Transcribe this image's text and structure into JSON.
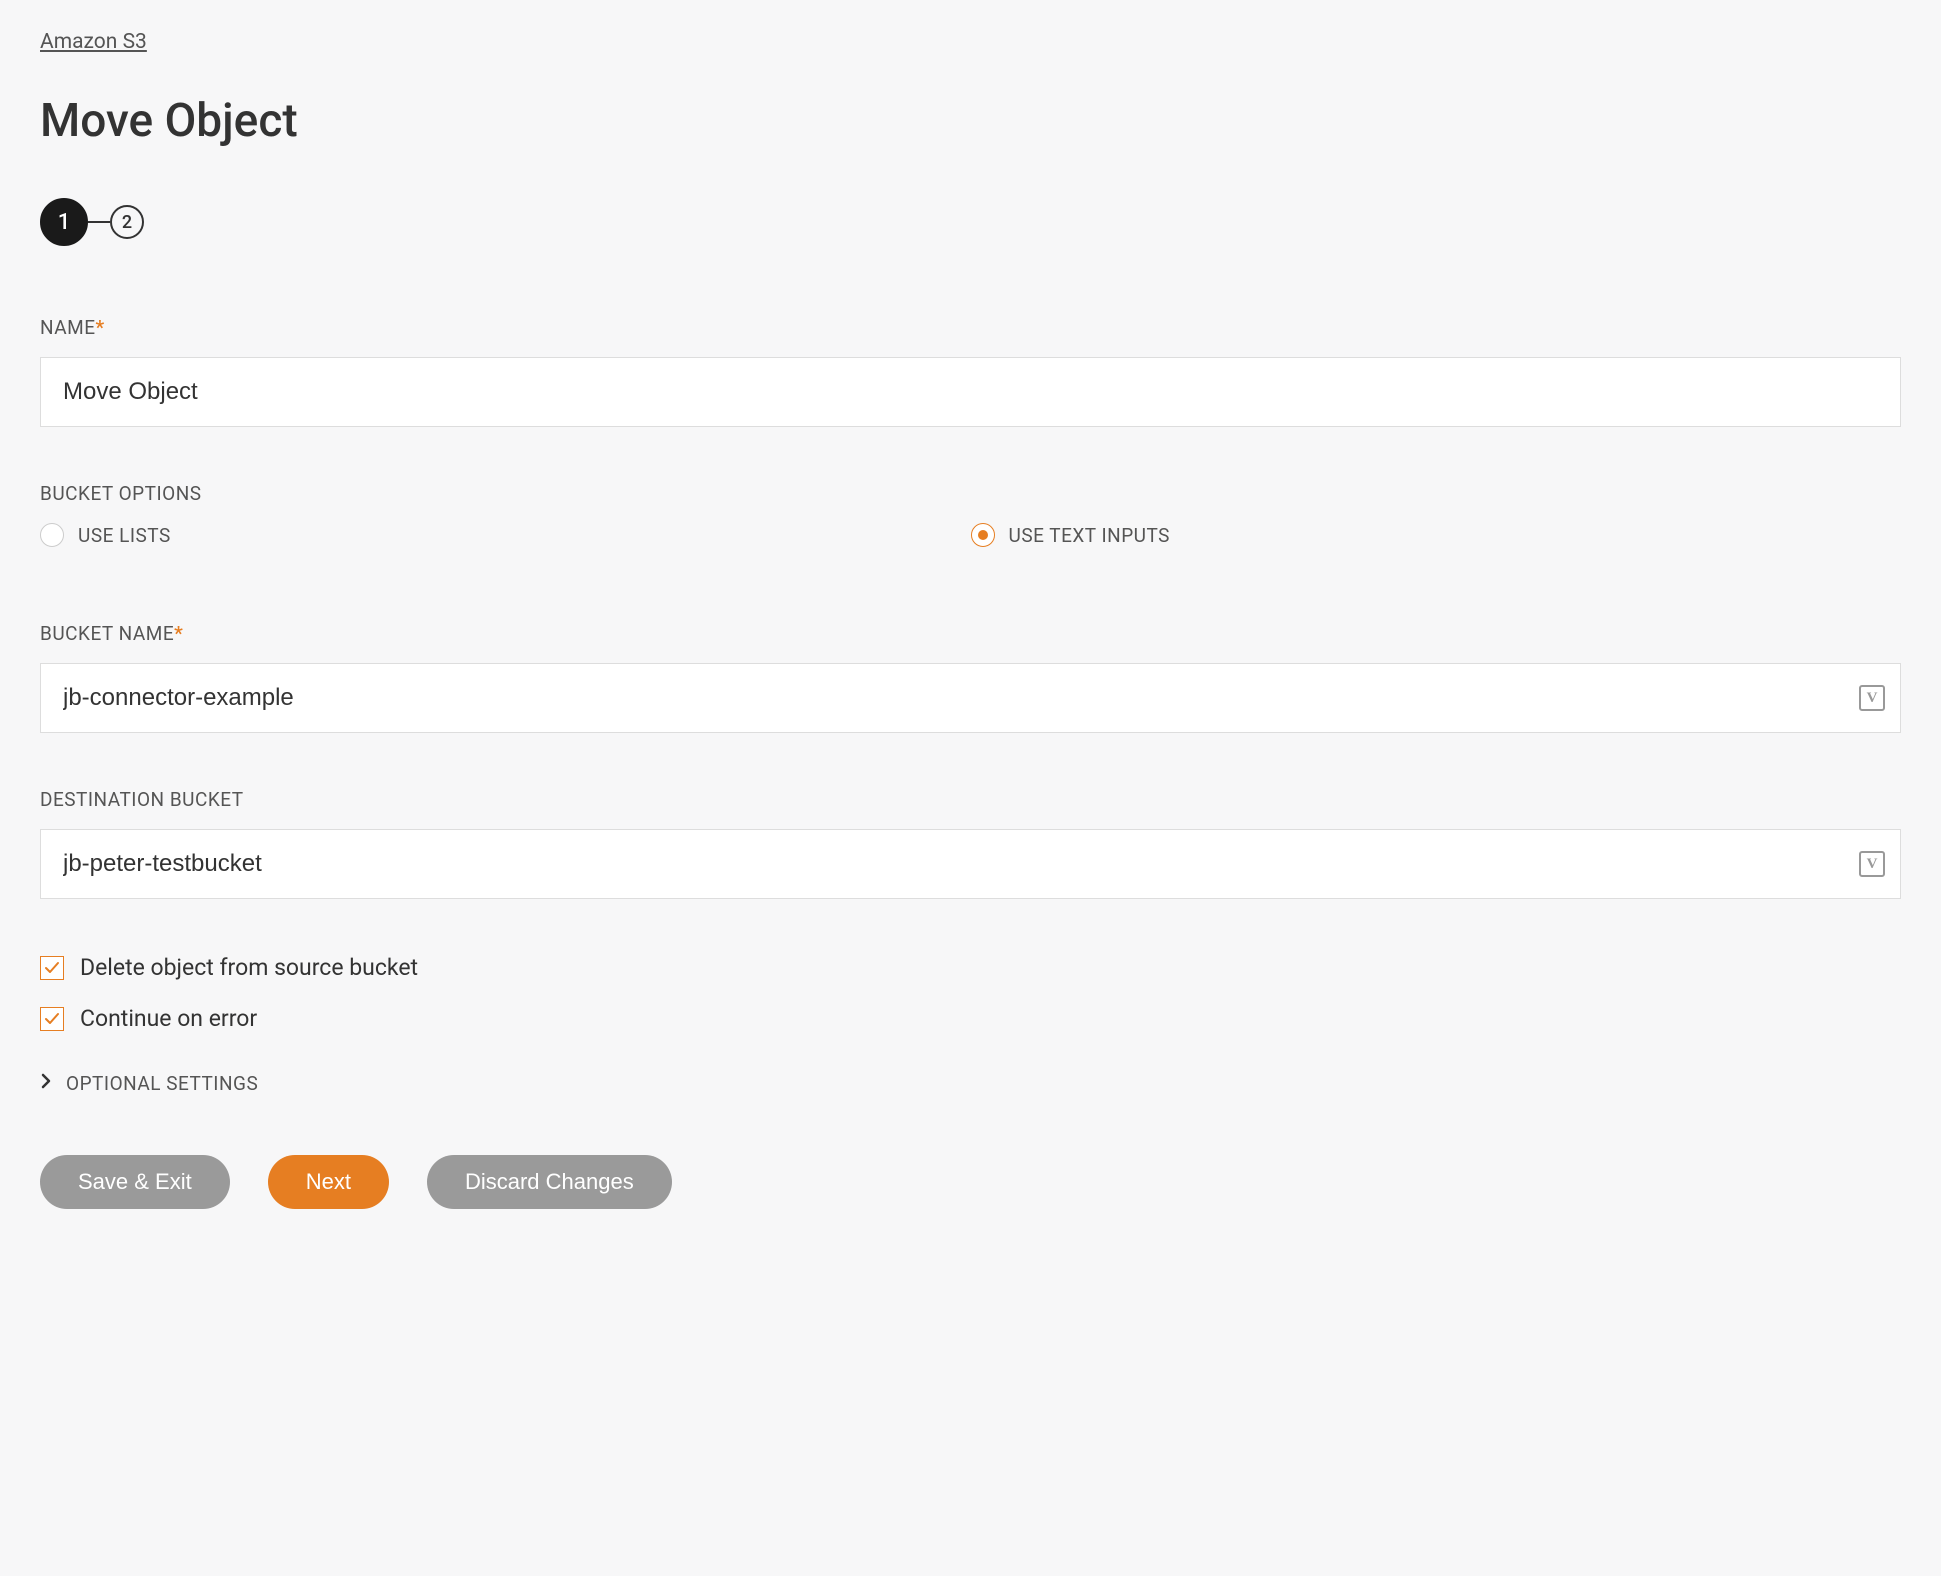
{
  "breadcrumb": {
    "label": "Amazon S3"
  },
  "page": {
    "title": "Move Object"
  },
  "stepper": {
    "step1": "1",
    "step2": "2"
  },
  "fields": {
    "name": {
      "label": "NAME",
      "value": "Move Object"
    },
    "bucketOptions": {
      "label": "BUCKET OPTIONS",
      "useLists": "USE LISTS",
      "useTextInputs": "USE TEXT INPUTS"
    },
    "bucketName": {
      "label": "BUCKET NAME",
      "value": "jb-connector-example"
    },
    "destinationBucket": {
      "label": "DESTINATION BUCKET",
      "value": "jb-peter-testbucket"
    },
    "deleteSource": {
      "label": "Delete object from source bucket"
    },
    "continueOnError": {
      "label": "Continue on error"
    },
    "optionalSettings": {
      "label": "OPTIONAL SETTINGS"
    }
  },
  "buttons": {
    "saveExit": "Save & Exit",
    "next": "Next",
    "discard": "Discard Changes"
  },
  "icons": {
    "varBadge": "V"
  }
}
